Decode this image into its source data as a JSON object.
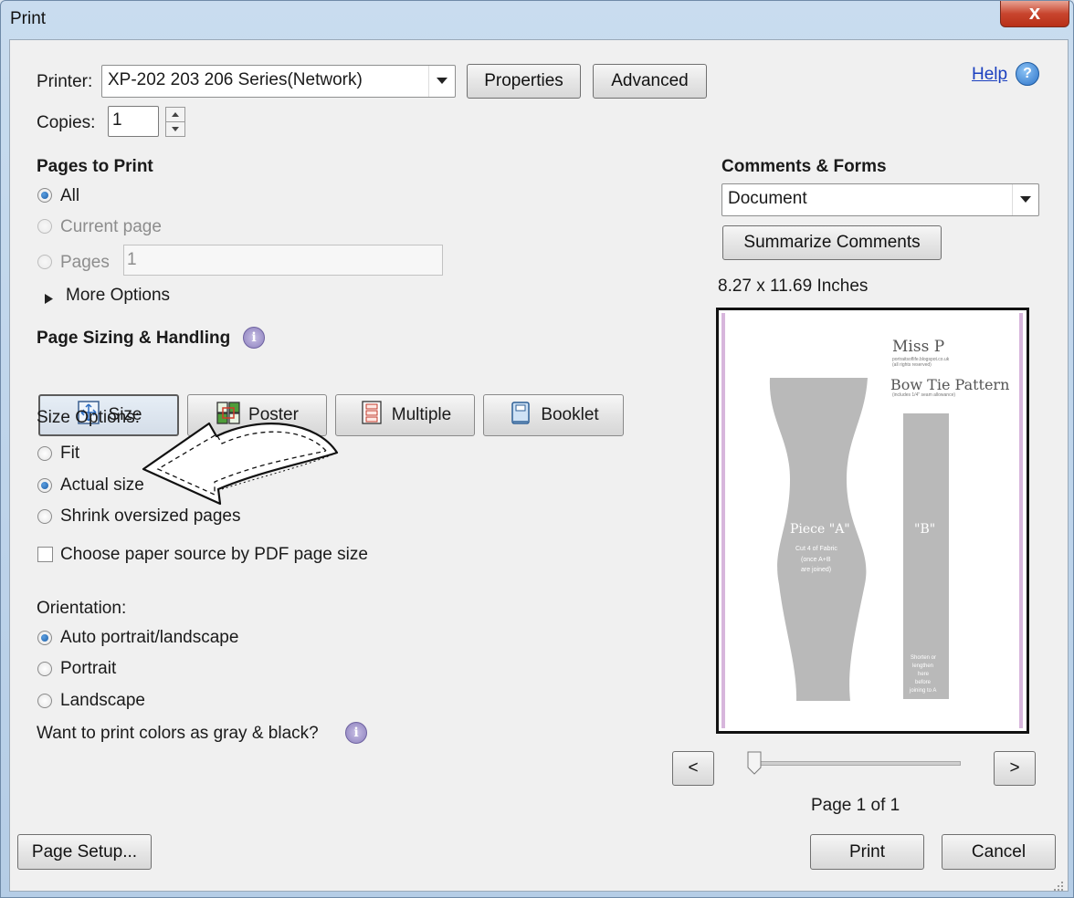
{
  "window": {
    "title": "Print",
    "close_label": "x"
  },
  "printer": {
    "label": "Printer:",
    "value": "XP-202 203 206 Series(Network)",
    "properties": "Properties",
    "advanced": "Advanced"
  },
  "help": {
    "label": "Help",
    "icon": "question"
  },
  "copies": {
    "label": "Copies:",
    "value": "1"
  },
  "pages_to_print": {
    "heading": "Pages to Print",
    "all": "All",
    "current": "Current page",
    "pages": "Pages",
    "pages_value": "1",
    "more_options": "More Options"
  },
  "sizing": {
    "heading": "Page Sizing & Handling",
    "modes": [
      "Size",
      "Poster",
      "Multiple",
      "Booklet"
    ],
    "size_options_label": "Size Options:",
    "fit": "Fit",
    "actual": "Actual size",
    "shrink": "Shrink oversized pages",
    "paper_source": "Choose paper source by PDF page size"
  },
  "orientation": {
    "label": "Orientation:",
    "auto": "Auto portrait/landscape",
    "portrait": "Portrait",
    "landscape": "Landscape"
  },
  "gray_label": "Want to print colors as gray & black?",
  "comments": {
    "heading": "Comments & Forms",
    "value": "Document",
    "summarize": "Summarize Comments"
  },
  "paper_size": "8.27 x 11.69 Inches",
  "preview": {
    "title": "Miss P",
    "subtitle_1": "portraitsoflife.blogspot.co.uk",
    "subtitle_2": "(all rights reserved)",
    "pattern": "Bow Tie Pattern",
    "note": "(includes 1/4\" seam allowance)",
    "piece_a": "Piece \"A\"",
    "piece_a_note_1": "Cut 4 of Fabric",
    "piece_a_note_2": "(once A+B",
    "piece_a_note_3": "are joined)",
    "piece_b": "\"B\"",
    "piece_b_note_1": "Shorten or",
    "piece_b_note_2": "lengthen",
    "piece_b_note_3": "here",
    "piece_b_note_4": "before",
    "piece_b_note_5": "joining to A"
  },
  "nav": {
    "prev": "<",
    "next": ">",
    "page_status": "Page 1 of 1"
  },
  "footer": {
    "page_setup": "Page Setup...",
    "print": "Print",
    "cancel": "Cancel"
  },
  "colors": {
    "accent": "#1e5fa8",
    "link": "#1a3fbf"
  }
}
